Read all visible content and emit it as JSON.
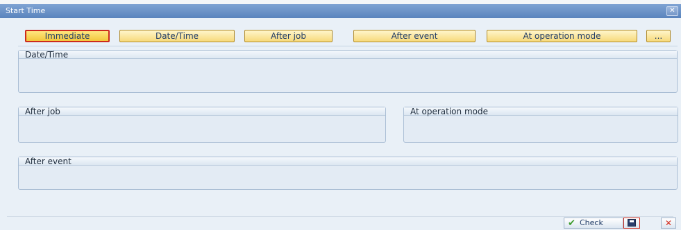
{
  "window": {
    "title": "Start Time",
    "close_glyph": "✕"
  },
  "toolbar": {
    "buttons": [
      {
        "label": "Immediate",
        "selected": true
      },
      {
        "label": "Date/Time",
        "selected": false
      },
      {
        "label": "After job",
        "selected": false
      },
      {
        "label": "After event",
        "selected": false
      },
      {
        "label": "At operation mode",
        "selected": false
      },
      {
        "label": "...",
        "selected": false
      }
    ]
  },
  "groups": {
    "datetime": {
      "title": "Date/Time"
    },
    "after_job": {
      "title": "After job"
    },
    "at_operation_mode": {
      "title": "At operation mode"
    },
    "after_event": {
      "title": "After event"
    }
  },
  "footer": {
    "check_label": "Check",
    "check_icon": "check-icon",
    "save_icon": "save-icon",
    "cancel_glyph": "✕"
  },
  "colors": {
    "titlebar": "#6b93c8",
    "window_bg": "#e9f0f7",
    "button_yellow": "#f7d97a",
    "selected_border": "#cc2a1c",
    "check_green": "#3a9a2a",
    "cancel_red": "#d42a1a"
  }
}
